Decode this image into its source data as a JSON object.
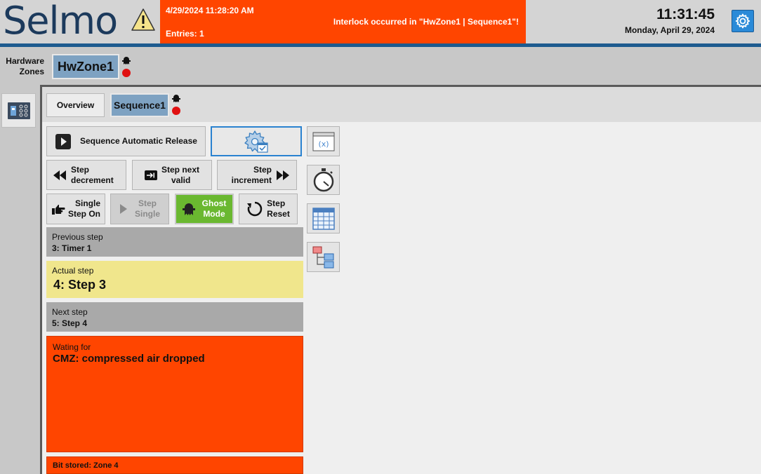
{
  "header": {
    "logo": "Selmo",
    "alarm": {
      "timestamp": "4/29/2024 11:28:20 AM",
      "entries": "Entries: 1",
      "message": "Interlock occurred in \"HwZone1 | Sequence1\"!",
      "color": "#ff4500"
    },
    "clock_time": "11:31:45",
    "clock_date": "Monday, April 29, 2024",
    "settings_icon": "gear-icon"
  },
  "hardware_zones": {
    "label_line1": "Hardware",
    "label_line2": "Zones",
    "zone": "HwZone1"
  },
  "tabs": {
    "overview": "Overview",
    "sequence": "Sequence1"
  },
  "controls": {
    "release": "Sequence Automatic Release",
    "step_decrement": [
      "Step",
      "decrement"
    ],
    "step_next_valid": [
      "Step next",
      "valid"
    ],
    "step_increment": [
      "Step",
      "increment"
    ],
    "single_step_on": [
      "Single",
      "Step On"
    ],
    "step_single": [
      "Step",
      "Single"
    ],
    "ghost_mode": [
      "Ghost",
      "Mode"
    ],
    "step_reset": [
      "Step",
      "Reset"
    ]
  },
  "steps": {
    "previous_caption": "Previous step",
    "previous_value": "3: Timer 1",
    "actual_caption": "Actual step",
    "actual_value": "4: Step 3",
    "next_caption": "Next step",
    "next_value": "5: Step 4",
    "waiting_caption": "Wating for",
    "waiting_value": "CMZ: compressed air dropped",
    "bit_stored": "Bit stored: Zone 4"
  },
  "colors": {
    "accent_blue": "#1d5b8f",
    "selected_tab": "#7ea2c2",
    "ghost_green": "#6ab830",
    "actual_yellow": "#f0e68c",
    "alarm_red": "#ff4500"
  }
}
